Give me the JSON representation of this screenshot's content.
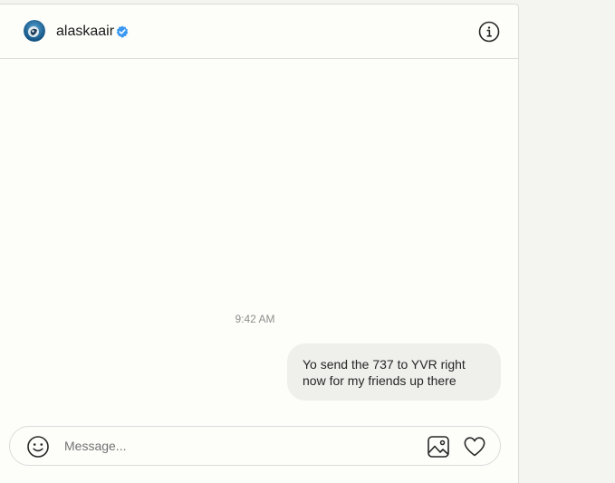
{
  "header": {
    "username": "alaskaair",
    "verified": true,
    "avatar_icon": "alaska-airlines-logo-icon",
    "info_icon": "info-icon"
  },
  "conversation": {
    "timestamp": "9:42 AM",
    "messages": [
      {
        "sender": "self",
        "text": "Yo send the 737 to YVR right now for my friends up there"
      }
    ]
  },
  "composer": {
    "placeholder": "Message...",
    "value": "",
    "emoji_icon": "emoji-icon",
    "image_icon": "image-icon",
    "like_icon": "heart-icon"
  },
  "colors": {
    "panel_bg": "#fdfdfa",
    "bubble_bg": "#efefec",
    "verified_blue": "#3897f0",
    "divider": "#dbdbdb"
  }
}
